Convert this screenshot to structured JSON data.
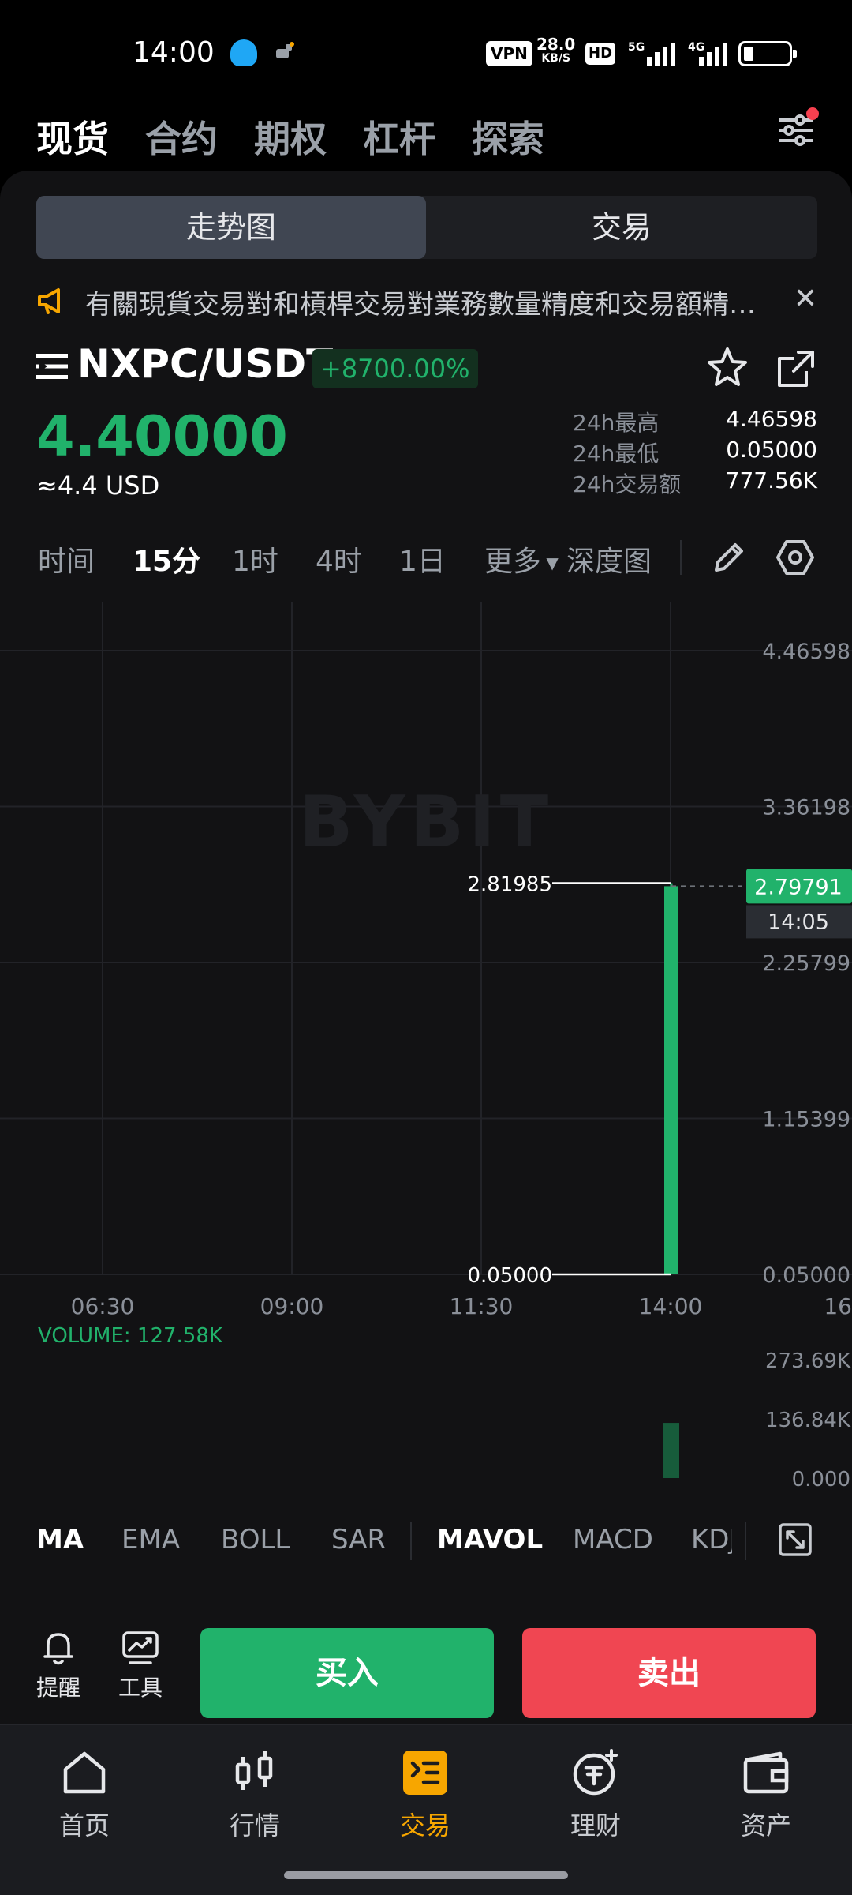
{
  "status_bar": {
    "time": "14:00",
    "vpn": "VPN",
    "speed_value": "28.0",
    "speed_unit": "KB/S",
    "hd": "HD",
    "net1": "5G",
    "net2": "4G"
  },
  "top_tabs": [
    "现货",
    "合约",
    "期权",
    "杠杆",
    "探索"
  ],
  "segment": {
    "chart": "走势图",
    "trade": "交易"
  },
  "notice": {
    "text": "有關現貨交易對和槓桿交易對業務數量精度和交易額精…"
  },
  "pair": {
    "name": "NXPC/USDT",
    "change": "+8700.00%",
    "price": "4.40000",
    "price_usd": "≈4.4 USD",
    "stats": [
      {
        "label": "24h最高",
        "value": "4.46598"
      },
      {
        "label": "24h最低",
        "value": "0.05000"
      },
      {
        "label": "24h交易额",
        "value": "777.56K"
      }
    ]
  },
  "intervals": [
    "时间",
    "15分",
    "1时",
    "4时",
    "1日",
    "更多",
    "深度图"
  ],
  "indicators": [
    "MA",
    "EMA",
    "BOLL",
    "SAR",
    "MAVOL",
    "MACD",
    "KDJ"
  ],
  "chart_data": {
    "type": "candlestick",
    "watermark": "BYBIT",
    "y_ticks": [
      "4.46598",
      "3.36198",
      "2.25799",
      "1.15399",
      "0.05000"
    ],
    "y_tick_values": [
      4.46598,
      3.36198,
      2.25799,
      1.15399,
      0.05
    ],
    "ylim": [
      0.05,
      4.46598
    ],
    "x_ticks": [
      "06:30",
      "09:00",
      "11:30",
      "14:00",
      "16"
    ],
    "candles": [
      {
        "time": "14:00",
        "open": 0.05,
        "high": 2.81985,
        "low": 0.05,
        "close": 2.79791
      }
    ],
    "high_label": "2.81985",
    "low_label": "0.05000",
    "current_price": "2.79791",
    "current_time": "14:05",
    "volume_label": "VOLUME: 127.58K",
    "volume_ticks": [
      "273.69K",
      "136.84K",
      "0.000"
    ],
    "volume_tick_values": [
      273690,
      136840,
      0
    ],
    "volume_bars": [
      {
        "time": "14:00",
        "value": 127580
      }
    ],
    "colors": {
      "up": "#21b26b",
      "down": "#f04652",
      "grid": "#222328",
      "volume": "#175c3b"
    }
  },
  "actions": {
    "alert": "提醒",
    "tools": "工具",
    "buy": "买入",
    "sell": "卖出"
  },
  "bottom_nav": [
    "首页",
    "行情",
    "交易",
    "理财",
    "资产"
  ],
  "colors": {
    "accent": "#f7a600",
    "up": "#21b26b",
    "down": "#f04652"
  }
}
